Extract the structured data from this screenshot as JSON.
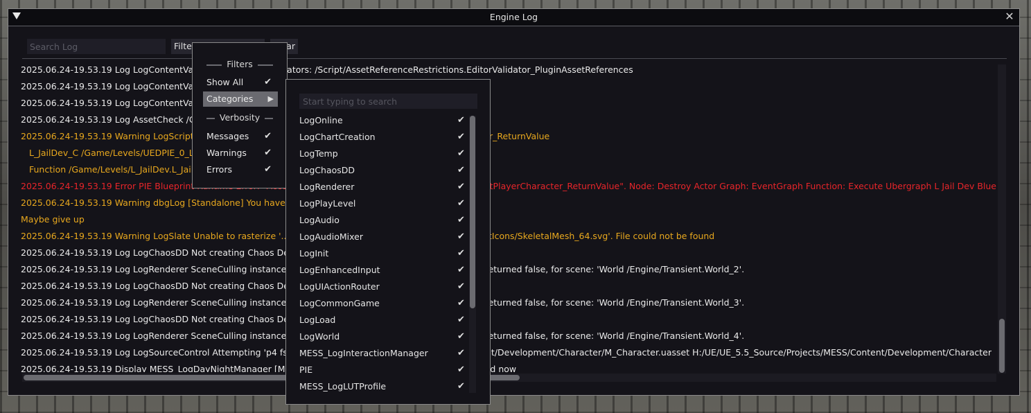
{
  "window": {
    "title": "Engine Log",
    "close_glyph": "✕"
  },
  "toolbar": {
    "search_placeholder": "Search Log",
    "filters_label": "Filters",
    "second_label": "",
    "clear_label": "Clear"
  },
  "log": {
    "lines": [
      {
        "text": "2025.06.24-19.53.19 Log LogContentValidation Enabled validators: /Script/AssetReferenceRestrictions.EditorValidator_PluginAssetReferences",
        "level": "normal"
      },
      {
        "text": "2025.06.24-19.53.19 Log LogContentValidation Enabled validators: /Script/AssetReferenceRestrictions",
        "level": "normal"
      },
      {
        "text": "2025.06.24-19.53.19 Log LogContentValidation Enabled validators: /Script/DataValidator",
        "level": "normal"
      },
      {
        "text": "2025.06.24-19.53.19 Log AssetCheck /Game/",
        "level": "normal"
      },
      {
        "text": "2025.06.24-19.53.19 Warning LogScript Accessed None trying to read property CallFunc_GetPlayerCharacter_ReturnValue",
        "level": "warning"
      },
      {
        "text": "L_JailDev_C /Game/Levels/UEDPIE_0_L_JailDev.L_JailDev:PersistentLevel.L_JailDev_C_0",
        "level": "warning",
        "indent": true
      },
      {
        "text": "Function /Game/Levels/L_JailDev.L_JailDev_C:ExecuteUbergraph_L_JailDev:0000",
        "level": "warning",
        "indent": true
      },
      {
        "text": "2025.06.24-19.53.19 Error PIE Blueprint Runtime Error: \"Accessed None trying to read property CallFunc_GetPlayerCharacter_ReturnValue\". Node:  Destroy Actor Graph:  EventGraph Function:  Execute Ubergraph L Jail Dev Blueprint:  L_JailDev",
        "level": "error"
      },
      {
        "text": "2025.06.24-19.53.19 Warning dbgLog [Standalone] You have something to do.",
        "level": "warning"
      },
      {
        "text": "Maybe give up",
        "level": "warning"
      },
      {
        "text": "2025.06.24-19.53.19 Warning LogSlate Unable to rasterize '../../../Engine/Content/Editor/Slate/Starship/AssetIcons/SkeletalMesh_64.svg'. File could not be found",
        "level": "warning"
      },
      {
        "text": "2025.06.24-19.53.19 Log LogChaosDD Not creating Chaos Debug Draw for scene",
        "level": "normal"
      },
      {
        "text": "2025.06.24-19.53.19 Log LogRenderer SceneCulling instance hierarchy is disabled as UseNanite(Platform) returned false, for scene: 'World /Engine/Transient.World_2'.",
        "level": "normal"
      },
      {
        "text": "2025.06.24-19.53.19 Log LogChaosDD Not creating Chaos Debug Draw for scene",
        "level": "normal"
      },
      {
        "text": "2025.06.24-19.53.19 Log LogRenderer SceneCulling instance hierarchy is disabled as UseNanite(Platform) returned false, for scene: 'World /Engine/Transient.World_3'.",
        "level": "normal"
      },
      {
        "text": "2025.06.24-19.53.19 Log LogChaosDD Not creating Chaos Debug Draw for scene",
        "level": "normal"
      },
      {
        "text": "2025.06.24-19.53.19 Log LogRenderer SceneCulling instance hierarchy is disabled as UseNanite(Platform) returned false, for scene: 'World /Engine/Transient.World_4'.",
        "level": "normal"
      },
      {
        "text": "2025.06.24-19.53.19 Log LogSourceControl Attempting 'p4 fstat H:/UE/UE_5.5_Source/Projects/MESS/Content/Development/Character/M_Character.uasset H:/UE/UE_5.5_Source/Projects/MESS/Content/Development/Character",
        "level": "normal"
      },
      {
        "text": "2025.06.24-19.53.19 Display MESS_LogDayNightManager [MESS_LogDayNightManager] Time of day updated now",
        "level": "normal"
      }
    ]
  },
  "filters_menu": {
    "heading_filters": "Filters",
    "show_all": "Show All",
    "categories": "Categories",
    "heading_verbosity": "Verbosity",
    "messages": "Messages",
    "warnings": "Warnings",
    "errors": "Errors",
    "check_glyph": "✔",
    "arrow_glyph": "▶"
  },
  "categories_menu": {
    "search_placeholder": "Start typing to search",
    "items": [
      {
        "label": "LogOnline",
        "checked": true
      },
      {
        "label": "LogChartCreation",
        "checked": true
      },
      {
        "label": "LogTemp",
        "checked": true
      },
      {
        "label": "LogChaosDD",
        "checked": true
      },
      {
        "label": "LogRenderer",
        "checked": true
      },
      {
        "label": "LogPlayLevel",
        "checked": true
      },
      {
        "label": "LogAudio",
        "checked": true
      },
      {
        "label": "LogAudioMixer",
        "checked": true
      },
      {
        "label": "LogInit",
        "checked": true
      },
      {
        "label": "LogEnhancedInput",
        "checked": true
      },
      {
        "label": "LogUIActionRouter",
        "checked": true
      },
      {
        "label": "LogCommonGame",
        "checked": true
      },
      {
        "label": "LogLoad",
        "checked": true
      },
      {
        "label": "LogWorld",
        "checked": true
      },
      {
        "label": "MESS_LogInteractionManager",
        "checked": true
      },
      {
        "label": "PIE",
        "checked": true
      },
      {
        "label": "MESS_LogLUTProfile",
        "checked": true
      }
    ]
  }
}
